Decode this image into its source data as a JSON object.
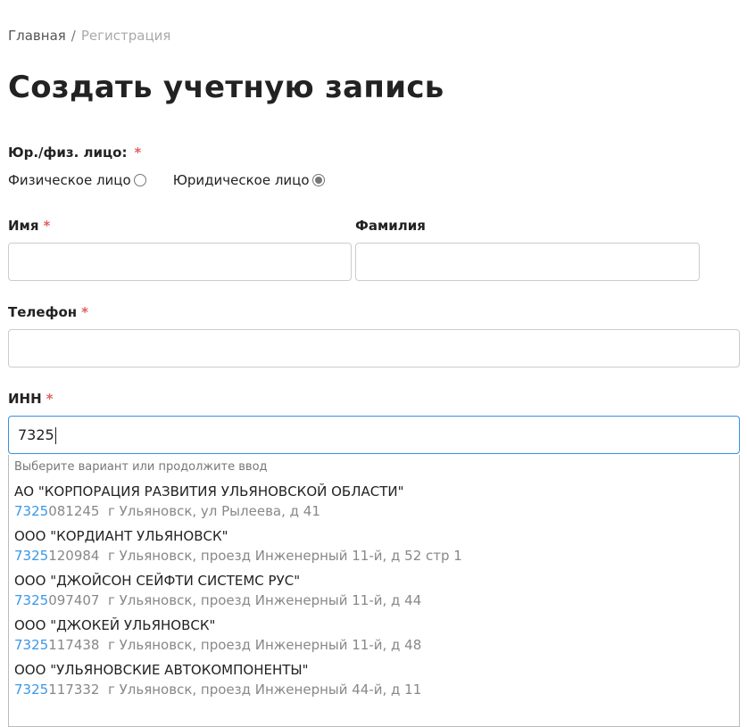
{
  "breadcrumb": {
    "home": "Главная",
    "separator": "/",
    "current": "Регистрация"
  },
  "page_title": "Создать учетную запись",
  "entity_type": {
    "label": "Юр./физ. лицо:",
    "required_mark": "*",
    "options": [
      {
        "label": "Физическое лицо",
        "selected": false
      },
      {
        "label": "Юридическое лицо",
        "selected": true
      }
    ]
  },
  "first_name": {
    "label": "Имя",
    "required_mark": "*",
    "value": ""
  },
  "last_name": {
    "label": "Фамилия",
    "value": ""
  },
  "phone": {
    "label": "Телефон",
    "required_mark": "*",
    "value": ""
  },
  "inn": {
    "label": "ИНН",
    "required_mark": "*",
    "value": "7325"
  },
  "suggestions": {
    "hint": "Выберите вариант или продолжите ввод",
    "items": [
      {
        "name": "АО \"КОРПОРАЦИЯ РАЗВИТИЯ УЛЬЯНОВСКОЙ ОБЛАСТИ\"",
        "inn_match": "7325",
        "inn_rest": "081245",
        "address": "г Ульяновск, ул Рылеева, д 41"
      },
      {
        "name": "ООО \"КОРДИАНТ УЛЬЯНОВСК\"",
        "inn_match": "7325",
        "inn_rest": "120984",
        "address": "г Ульяновск, проезд Инженерный 11-й, д 52 стр 1"
      },
      {
        "name": "ООО \"ДЖОЙСОН СЕЙФТИ СИСТЕМС РУС\"",
        "inn_match": "7325",
        "inn_rest": "097407",
        "address": "г Ульяновск, проезд Инженерный 11-й, д 44"
      },
      {
        "name": "ООО \"ДЖОКЕЙ УЛЬЯНОВСК\"",
        "inn_match": "7325",
        "inn_rest": "117438",
        "address": "г Ульяновск, проезд Инженерный 11-й, д 48"
      },
      {
        "name": "ООО \"УЛЬЯНОВСКИЕ АВТОКОМПОНЕНТЫ\"",
        "inn_match": "7325",
        "inn_rest": "117332",
        "address": "г Ульяновск, проезд Инженерный 44-й, д 11"
      }
    ]
  }
}
